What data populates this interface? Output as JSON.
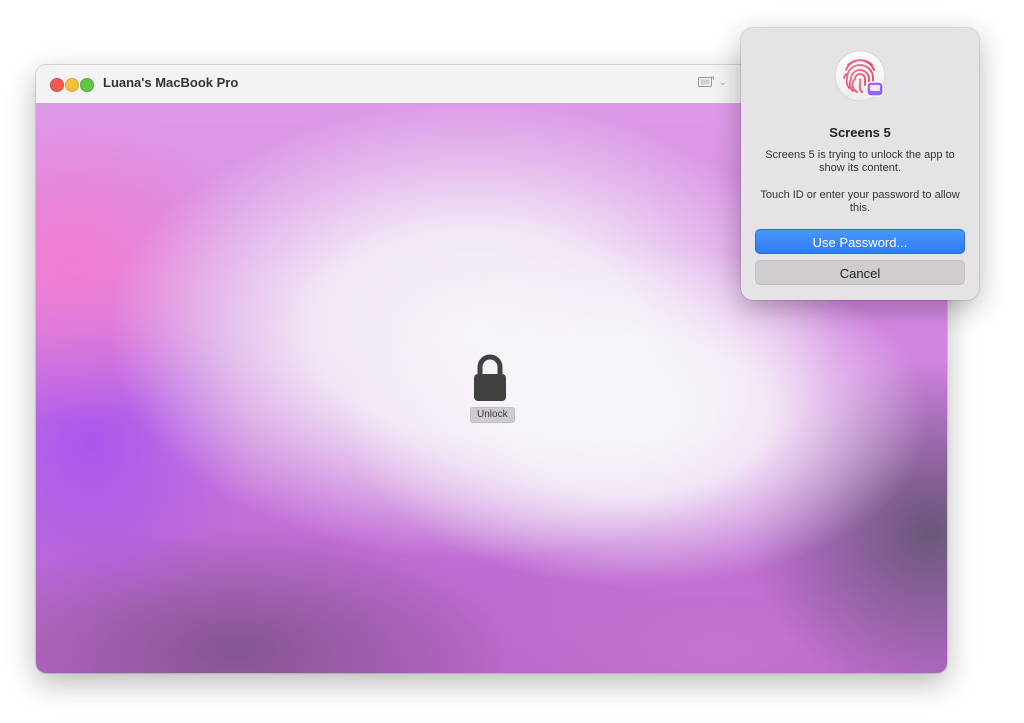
{
  "window": {
    "title": "Luana's MacBook Pro",
    "toolbar": {
      "display_icon": "display-icon",
      "dropdown_icon": "chevron-down-icon",
      "dropdown_glyph": "⌄"
    },
    "content": {
      "lock_icon": "lock-icon",
      "unlock_label": "Unlock"
    }
  },
  "dialog": {
    "icon": "touch-id-fingerprint-icon",
    "title": "Screens 5",
    "message_1": "Screens 5 is trying to unlock the app to show its content.",
    "message_2": "Touch ID or enter your password to allow this.",
    "primary_button": "Use Password...",
    "secondary_button": "Cancel"
  },
  "colors": {
    "accent": "#2d7cf5",
    "traffic_close": "#ee5b55",
    "traffic_minimize": "#f4bd3b",
    "traffic_maximize": "#5fc648"
  }
}
